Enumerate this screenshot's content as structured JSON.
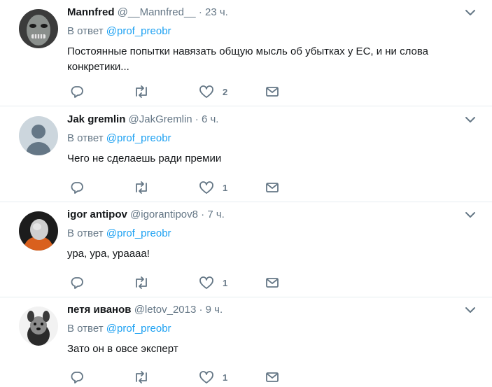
{
  "tweets": [
    {
      "name": "Mannfred",
      "handle": "@__Mannfred__",
      "time": "23 ч.",
      "reply_prefix": "В ответ",
      "reply_to": "@prof_preobr",
      "text": "Постоянные попытки навязать общую мысль об убытках у ЕС, и ни слова конкретики...",
      "likes": "2"
    },
    {
      "name": "Jak gremlin",
      "handle": "@JakGremlin",
      "time": "6 ч.",
      "reply_prefix": "В ответ",
      "reply_to": "@prof_preobr",
      "text": "Чего не сделаешь ради премии",
      "likes": "1"
    },
    {
      "name": "igor antipov",
      "handle": "@igorantipov8",
      "time": "7 ч.",
      "reply_prefix": "В ответ",
      "reply_to": "@prof_preobr",
      "text": "ура, ура, урaaaa!",
      "likes": "1"
    },
    {
      "name": "петя иванов",
      "handle": "@letov_2013",
      "time": "9 ч.",
      "reply_prefix": "В ответ",
      "reply_to": "@prof_preobr",
      "text": "Зато он в овсе эксперт",
      "likes": "1"
    }
  ],
  "separator": "·",
  "icons": {
    "reply": "reply-icon",
    "retweet": "retweet-icon",
    "like": "heart-icon",
    "dm": "envelope-icon",
    "more": "chevron-down-icon"
  },
  "colors": {
    "mention": "#1da1f2",
    "muted": "#657786",
    "text": "#14171a",
    "divider": "#e6ecf0"
  }
}
